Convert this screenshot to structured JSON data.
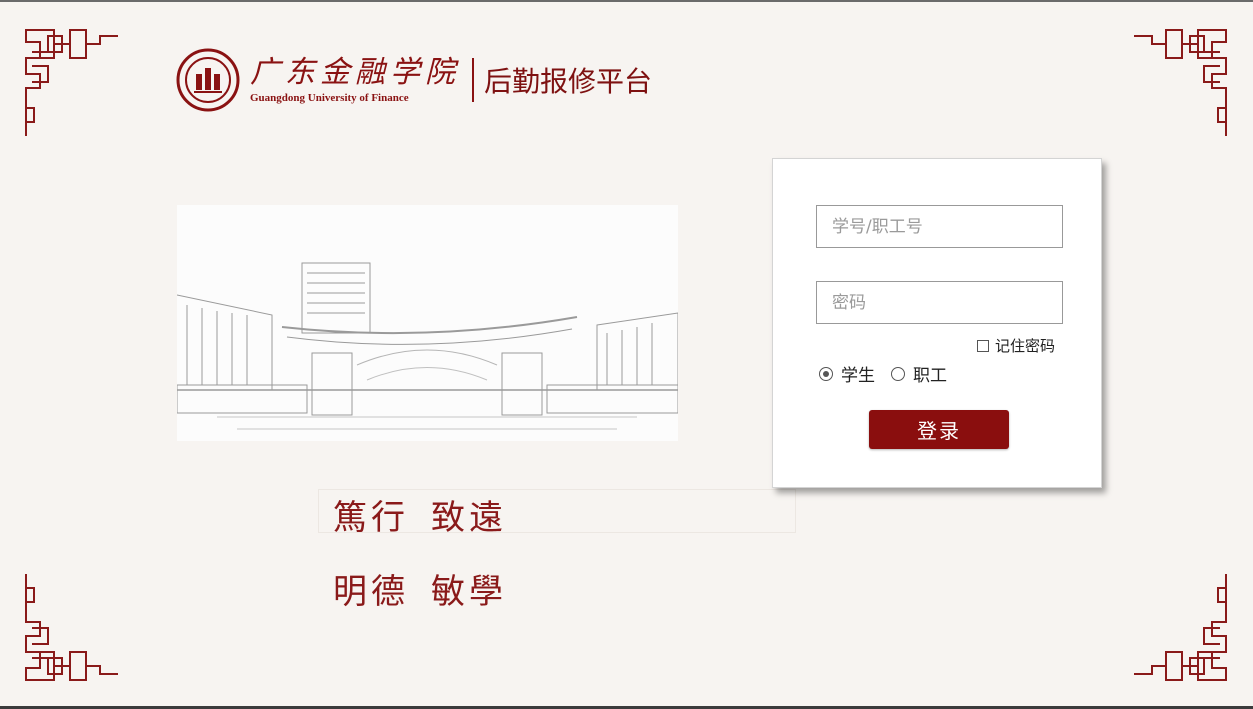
{
  "header": {
    "school_name_cn": "广东金融学院",
    "school_name_en": "Guangdong University of Finance",
    "platform_title": "后勤报修平台",
    "logo_icon": "university-seal-icon"
  },
  "motto": {
    "line1_left": "篤行",
    "line1_right": "致遠",
    "line2_left": "明德",
    "line2_right": "敏學"
  },
  "login": {
    "username_placeholder": "学号/职工号",
    "password_placeholder": "密码",
    "remember_label": "记住密码",
    "roles": [
      {
        "label": "学生",
        "selected": true
      },
      {
        "label": "职工",
        "selected": false
      }
    ],
    "submit_label": "登录"
  },
  "colors": {
    "brand_red": "#8a0e0e",
    "background": "#f7f4f1"
  }
}
